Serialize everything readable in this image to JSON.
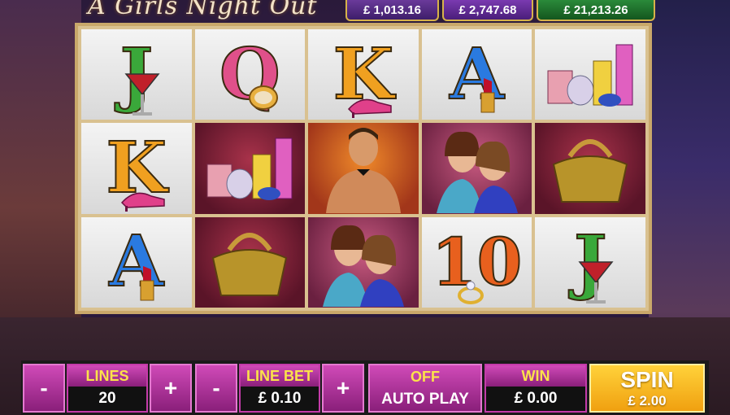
{
  "game": {
    "title": "A Girls Night Out"
  },
  "jackpots": [
    {
      "value": "£ 1,013.16"
    },
    {
      "value": "£ 2,747.68"
    },
    {
      "value": "£ 21,213.26"
    }
  ],
  "reels": [
    [
      "J",
      "Q",
      "K",
      "A",
      "perfume-bottles"
    ],
    [
      "K",
      "perfume-bottles",
      "bartender",
      "two-women",
      "handbag"
    ],
    [
      "A",
      "handbag",
      "two-women",
      "10",
      "J"
    ]
  ],
  "controls": {
    "lines_label": "LINES",
    "lines_value": "20",
    "linebet_label": "LINE BET",
    "linebet_value": "£ 0.10",
    "minus": "-",
    "plus": "+",
    "autoplay_state": "OFF",
    "autoplay_label": "AUTO PLAY",
    "win_label": "WIN",
    "win_value": "£ 0.00",
    "spin_label": "SPIN",
    "spin_cost": "£ 2.00"
  },
  "colors": {
    "accent_pink": "#c33ba9",
    "label_yellow": "#fbe24a",
    "spin_orange": "#f0a010"
  }
}
